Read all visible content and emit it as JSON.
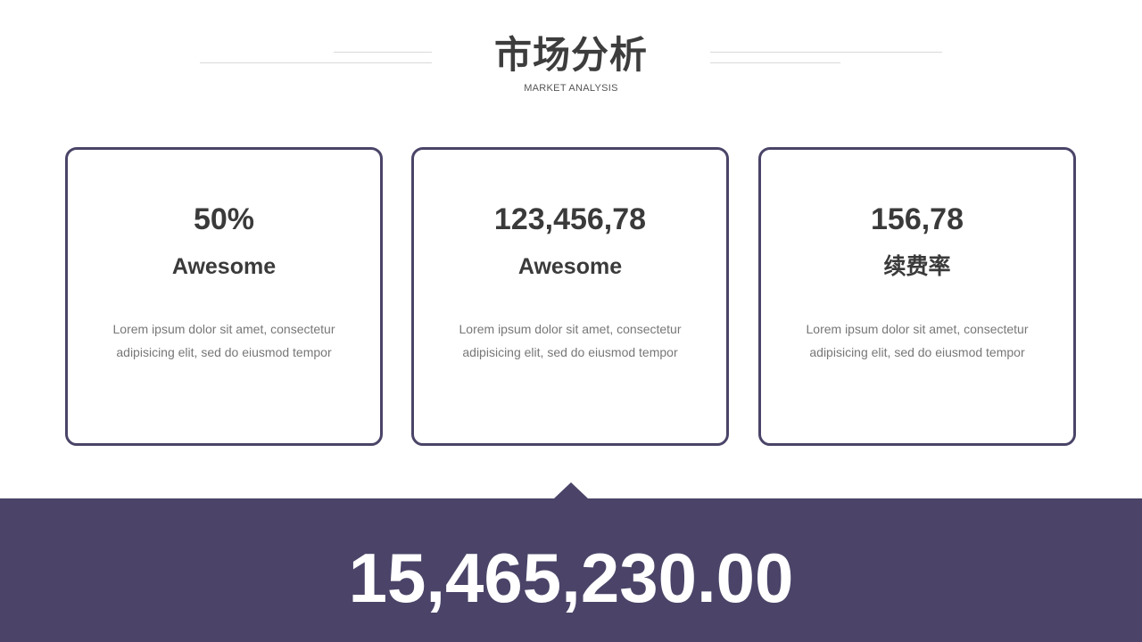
{
  "header": {
    "title": "市场分析",
    "subtitle": "MARKET ANALYSIS"
  },
  "cards": [
    {
      "value": "50%",
      "label": "Awesome",
      "description": "Lorem ipsum dolor sit amet, consectetur adipisicing elit, sed do eiusmod tempor"
    },
    {
      "value": "123,456,78",
      "label": "Awesome",
      "description": "Lorem ipsum dolor sit amet, consectetur adipisicing elit, sed do eiusmod tempor"
    },
    {
      "value": "156,78",
      "label": "续费率",
      "description": "Lorem ipsum dolor sit amet, consectetur adipisicing elit, sed do eiusmod tempor"
    }
  ],
  "summary": {
    "total": "15,465,230.00"
  },
  "colors": {
    "accent": "#4b4468",
    "text_dark": "#3a3a3a",
    "text_muted": "#777777",
    "divider": "#d9d9d9"
  }
}
